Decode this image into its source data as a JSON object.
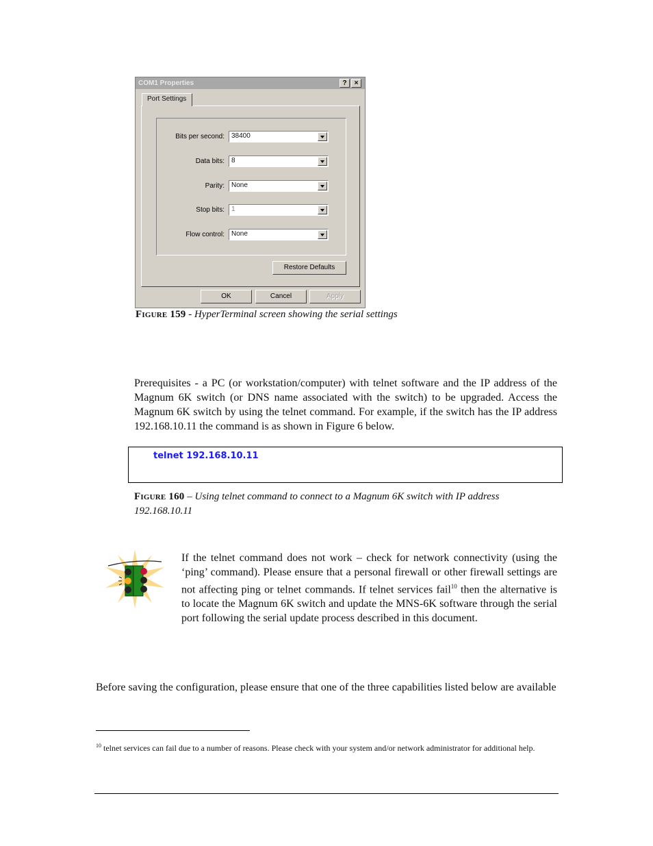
{
  "dialog": {
    "title": "COM1 Properties",
    "help_button": "?",
    "close_button": "×",
    "tab": "Port Settings",
    "fields": [
      {
        "label": "Bits per second:",
        "value": "38400"
      },
      {
        "label": "Data bits:",
        "value": "8"
      },
      {
        "label": "Parity:",
        "value": "None"
      },
      {
        "label": "Stop bits:",
        "value": "1"
      },
      {
        "label": "Flow control:",
        "value": "None"
      }
    ],
    "restore_defaults": "Restore Defaults",
    "ok": "OK",
    "cancel": "Cancel",
    "apply": "Apply"
  },
  "figure159": {
    "label": "Figure 159",
    "text": " - HyperTerminal screen showing the serial settings"
  },
  "prereq_paragraph": "Prerequisites - a PC (or workstation/computer) with telnet software and the IP address of the Magnum 6K switch (or DNS name associated with the switch) to be upgraded. Access the Magnum 6K switch by using the telnet command. For example, if the switch has the IP address 192.168.10.11 the command is as shown in Figure 6 below.",
  "code": "telnet 192.168.10.11",
  "figure160": {
    "label": "Figure 160",
    "text": " – Using telnet command to connect to a Magnum 6K switch with IP address 192.168.10.11"
  },
  "note": {
    "icon": "traffic-light-icon",
    "text_before": "If the telnet command does not work – check for network connectivity (using the ‘ping’ command). Please ensure that a personal firewall or other firewall settings are not affecting ping or telnet commands. If telnet services fail",
    "footnote_ref": "10",
    "text_after": " then the alternative is to locate the Magnum 6K switch and update the MNS-6K software through the serial port following the serial update process described in this document."
  },
  "saving_paragraph": "Before saving the configuration, please ensure that one of the three capabilities listed below are available",
  "footnote": {
    "number": "10",
    "text": " telnet services can fail due to a number of reasons. Please check with your system and/or network administrator for additional help."
  }
}
